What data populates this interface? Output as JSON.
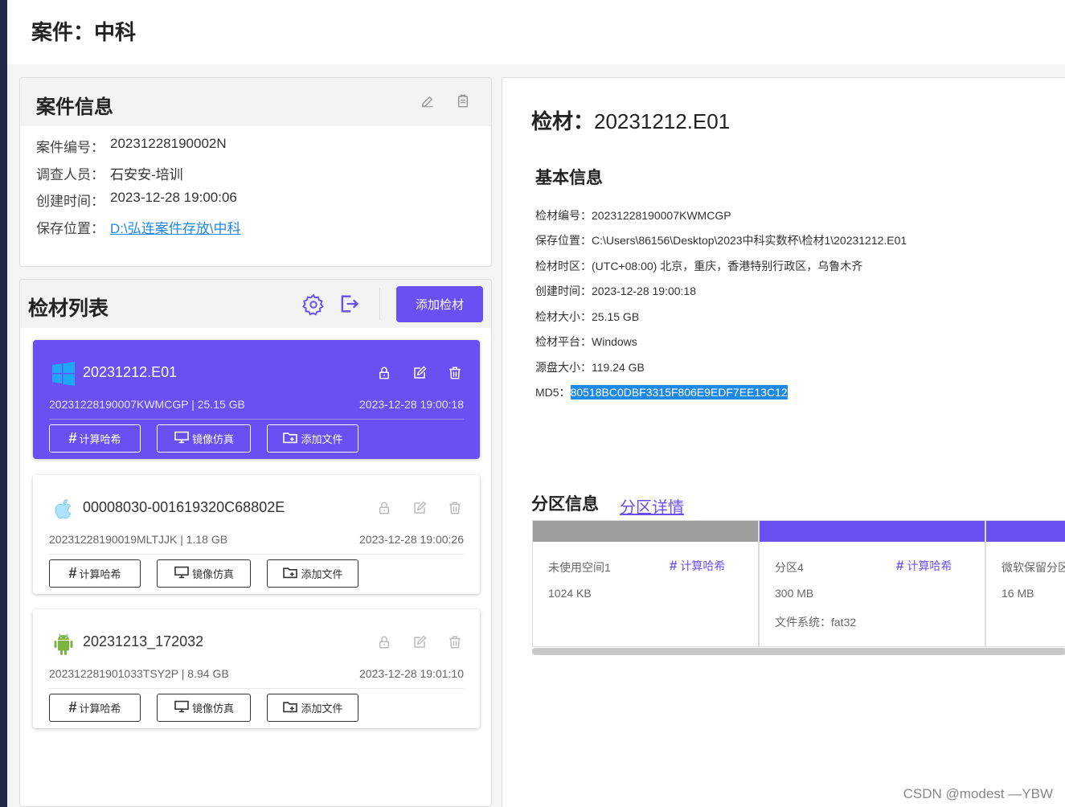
{
  "page": {
    "title": "案件：中科"
  },
  "case_info": {
    "heading": "案件信息",
    "rows": [
      {
        "key": "案件编号：",
        "value": "20231228190002N"
      },
      {
        "key": "调查人员：",
        "value": "石安安-培训"
      },
      {
        "key": "创建时间：",
        "value": "2023-12-28 19:00:06"
      },
      {
        "key": "保存位置：",
        "value": "D:\\弘连案件存放\\中科"
      }
    ]
  },
  "evidence_list": {
    "heading": "检材列表",
    "add_button": "添加检材",
    "button_labels": {
      "hash": "计算哈希",
      "mirror": "镜像仿真",
      "add_file": "添加文件"
    },
    "items": [
      {
        "os_icon": "windows-icon",
        "name": "20231212.E01",
        "meta": "20231228190007KWMCGP | 25.15 GB",
        "time": "2023-12-28 19:00:18",
        "active": true
      },
      {
        "os_icon": "apple-icon",
        "name": "00008030-001619320C68802E",
        "meta": "20231228190019MLTJJK | 1.18 GB",
        "time": "2023-12-28 19:00:26",
        "active": false
      },
      {
        "os_icon": "android-icon",
        "name": "20231213_172032",
        "meta": "202312281901033TSY2P | 8.94 GB",
        "time": "2023-12-28 19:01:10",
        "active": false
      }
    ]
  },
  "detail": {
    "title_label": "检材：",
    "title_value": "20231212.E01",
    "basic_heading": "基本信息",
    "rows": [
      {
        "key": "检材编号：",
        "value": "20231228190007KWMCGP"
      },
      {
        "key": "保存位置：",
        "value": "C:\\Users\\86156\\Desktop\\2023中科实数杯\\检材1\\20231212.E01"
      },
      {
        "key": "检材时区：",
        "value": "(UTC+08:00) 北京，重庆，香港特别行政区，乌鲁木齐"
      },
      {
        "key": "创建时间：",
        "value": "2023-12-28 19:00:18"
      },
      {
        "key": "检材大小：",
        "value": "25.15 GB"
      },
      {
        "key": "检材平台：",
        "value": "Windows"
      },
      {
        "key": "源盘大小：",
        "value": "119.24 GB"
      }
    ],
    "md5_key": "MD5：",
    "md5_value": "80518BC0DBF3315F806E9EDF7EE13C12",
    "partition_heading": "分区信息",
    "partition_link": "分区详情",
    "hash_label": "计算哈希",
    "fs_label": "文件系统：",
    "partitions": [
      {
        "name": "未使用空间1",
        "size": "1024 KB",
        "fs": "",
        "bar_color": "#9e9e9e"
      },
      {
        "name": "分区4",
        "size": "300 MB",
        "fs": "fat32",
        "bar_color": "#6a4ff2"
      },
      {
        "name": "微软保留分区",
        "size": "16 MB",
        "fs": "",
        "bar_color": "#6a4ff2"
      }
    ]
  },
  "watermark": "CSDN @modest —YBW",
  "colors": {
    "accent": "#6a4ff2",
    "link": "#1e88e5",
    "highlight": "#1e88e5"
  }
}
